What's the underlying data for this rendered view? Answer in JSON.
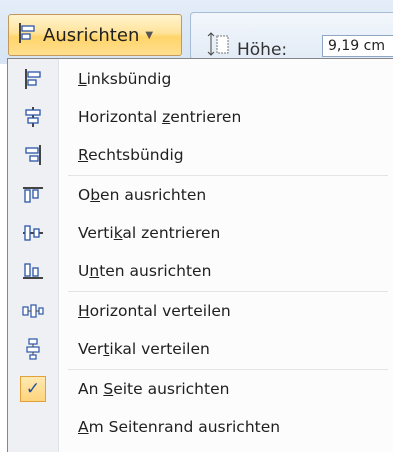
{
  "ribbon": {
    "align_button": {
      "label": "Ausrichten",
      "icon": "align-left-icon",
      "dropdown_icon": "chevron-down-icon"
    },
    "size": {
      "height_icon": "shape-height-icon",
      "height_label": "Höhe:",
      "height_value": "9,19 cm"
    }
  },
  "menu": {
    "items": [
      {
        "pre": "",
        "u": "L",
        "post": "inksbündig",
        "icon": "align-left-icon"
      },
      {
        "pre": "Horizontal ",
        "u": "z",
        "post": "entrieren",
        "icon": "align-center-icon"
      },
      {
        "pre": "",
        "u": "R",
        "post": "echtsbündig",
        "icon": "align-right-icon"
      },
      {
        "pre": "O",
        "u": "b",
        "post": "en ausrichten",
        "icon": "align-top-icon"
      },
      {
        "pre": "Verti",
        "u": "k",
        "post": "al zentrieren",
        "icon": "align-middle-icon"
      },
      {
        "pre": "U",
        "u": "n",
        "post": "ten ausrichten",
        "icon": "align-bottom-icon"
      },
      {
        "pre": "",
        "u": "H",
        "post": "orizontal verteilen",
        "icon": "distribute-horizontally-icon"
      },
      {
        "pre": "Ver",
        "u": "t",
        "post": "ikal verteilen",
        "icon": "distribute-vertically-icon"
      },
      {
        "pre": "An ",
        "u": "S",
        "post": "eite ausrichten",
        "icon": "checkmark-icon",
        "checked": true
      },
      {
        "pre": "",
        "u": "A",
        "post": "m Seitenrand ausrichten",
        "icon": ""
      }
    ]
  },
  "colors": {
    "icon_blue": "#2a55a8",
    "check_fill": "#ffd47c",
    "check_border": "#e3a13b",
    "button_fill": "#ffe39a"
  }
}
